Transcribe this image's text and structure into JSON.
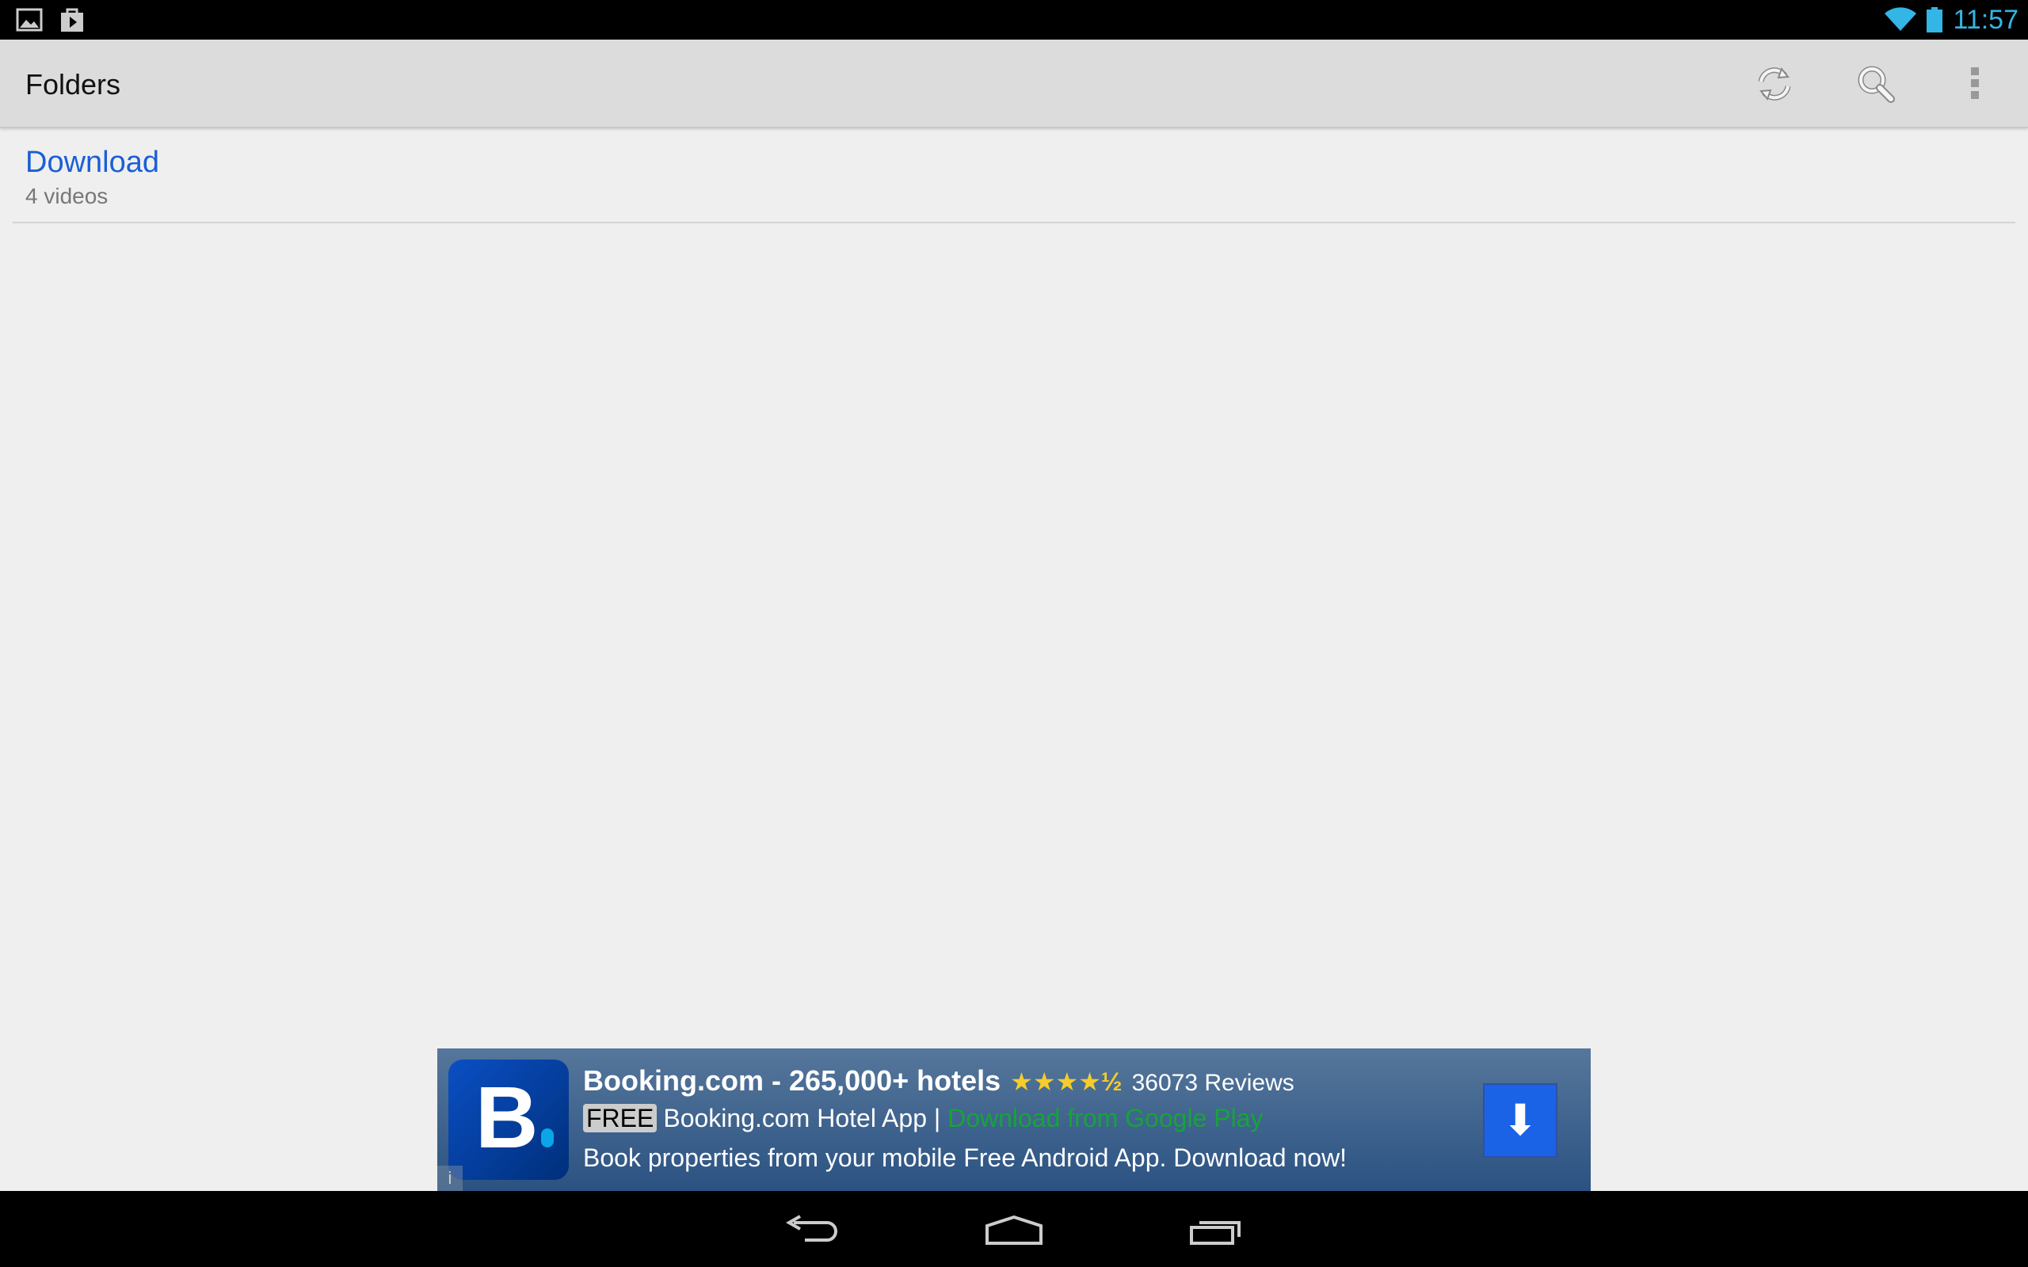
{
  "status_bar": {
    "time": "11:57",
    "left_icons": [
      "image-icon",
      "play-store-icon"
    ],
    "right_icons": [
      "wifi-icon",
      "battery-icon"
    ],
    "accent": "#33b5e5"
  },
  "action_bar": {
    "title": "Folders",
    "actions": [
      "refresh-icon",
      "search-icon",
      "overflow-menu-icon"
    ]
  },
  "folders": [
    {
      "name": "Download",
      "count": "4 videos"
    }
  ],
  "ad": {
    "title": "Booking.com - 265,000+ hotels",
    "rating": 4.5,
    "stars": "★★★★½",
    "reviews": "36073 Reviews",
    "badge": "FREE",
    "app_name": "Booking.com Hotel App",
    "separator": "|",
    "store_link": "Download from Google Play",
    "description": "Book properties from your mobile Free Android App. Download now!",
    "logo_letter": "B",
    "info": "i"
  },
  "nav_bar": {
    "buttons": [
      "back-icon",
      "home-icon",
      "recents-icon"
    ]
  }
}
